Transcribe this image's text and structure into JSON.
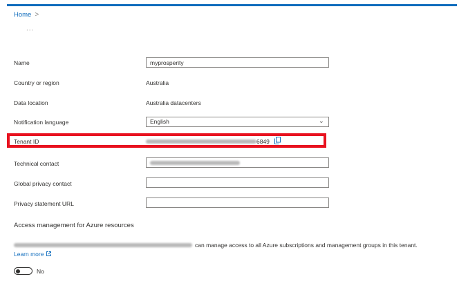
{
  "breadcrumb": {
    "home": "Home",
    "separator": ">"
  },
  "more_label": "...",
  "form": {
    "name": {
      "label": "Name",
      "value": "myprosperity"
    },
    "country": {
      "label": "Country or region",
      "value": "Australia"
    },
    "location": {
      "label": "Data location",
      "value": "Australia datacenters"
    },
    "notification": {
      "label": "Notification language",
      "value": "English"
    },
    "tenant": {
      "label": "Tenant ID",
      "value_suffix": "6849"
    },
    "technical": {
      "label": "Technical contact"
    },
    "privacy_contact": {
      "label": "Global privacy contact",
      "value": ""
    },
    "privacy_url": {
      "label": "Privacy statement URL",
      "value": ""
    }
  },
  "access": {
    "title": "Access management for Azure resources",
    "description": "can manage access to all Azure subscriptions and management groups in this tenant.",
    "learn_more": "Learn more",
    "toggle_label": "No"
  },
  "colors": {
    "accent": "#0f6cbd",
    "highlight": "#e8121f"
  }
}
